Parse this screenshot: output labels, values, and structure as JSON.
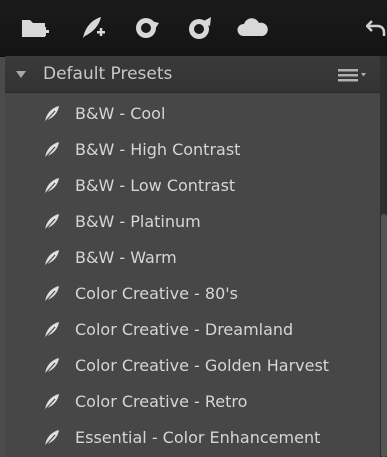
{
  "toolbar": {
    "buttons": [
      {
        "icon": "new-folder-icon"
      },
      {
        "icon": "new-preset-icon"
      },
      {
        "icon": "import-icon"
      },
      {
        "icon": "export-icon"
      },
      {
        "icon": "cloud-icon"
      },
      {
        "icon": "undo-arrow-icon"
      }
    ]
  },
  "panel": {
    "section_title": "Default Presets",
    "expanded": true,
    "items": [
      {
        "label": "B&W - Cool"
      },
      {
        "label": "B&W - High Contrast"
      },
      {
        "label": "B&W - Low Contrast"
      },
      {
        "label": "B&W - Platinum"
      },
      {
        "label": "B&W - Warm"
      },
      {
        "label": "Color Creative - 80's"
      },
      {
        "label": "Color Creative - Dreamland"
      },
      {
        "label": "Color Creative - Golden Harvest"
      },
      {
        "label": "Color Creative - Retro"
      },
      {
        "label": "Essential - Color Enhancement"
      }
    ]
  }
}
